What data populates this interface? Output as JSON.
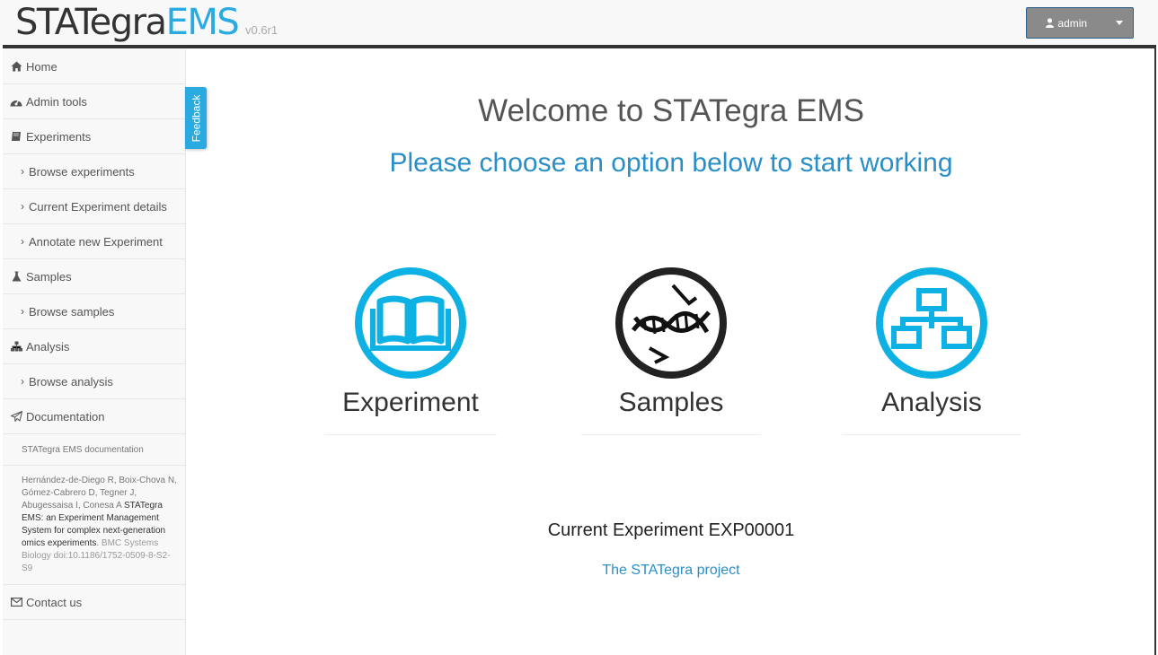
{
  "header": {
    "brand_part1": "STATegra",
    "brand_part2": "EMS",
    "version": "v0.6r1",
    "user_label": "admin"
  },
  "sidebar": {
    "items": [
      {
        "label": "Home",
        "icon": "home-icon"
      },
      {
        "label": "Admin tools",
        "icon": "dashboard-icon"
      },
      {
        "label": "Experiments",
        "icon": "book-icon"
      },
      {
        "label": "Browse experiments"
      },
      {
        "label": "Current Experiment details"
      },
      {
        "label": "Annotate new Experiment"
      },
      {
        "label": "Samples",
        "icon": "flask-icon"
      },
      {
        "label": "Browse samples"
      },
      {
        "label": "Analysis",
        "icon": "sitemap-icon"
      },
      {
        "label": "Browse analysis"
      },
      {
        "label": "Documentation",
        "icon": "paper-plane-icon"
      }
    ],
    "doc_link": "STATegra EMS documentation",
    "citation": {
      "authors": "Hernández-de-Diego R, Boix-Chova N, Gómez-Cabrero D, Tegner J, Abugessaisa I, Conesa A",
      "title": "STATegra EMS: an Experiment Management System for complex next-generation omics experiments",
      "journal": "BMC Systems Biology doi:10.1186/1752-0509-8-S2-S9"
    },
    "contact": {
      "label": "Contact us",
      "icon": "envelope-icon"
    }
  },
  "feedback_tab": "Feedback",
  "main": {
    "title": "Welcome to STATegra EMS",
    "subtitle": "Please choose an option below to start working",
    "options": [
      {
        "label": "Experiment",
        "icon": "open-book-icon"
      },
      {
        "label": "Samples",
        "icon": "dna-icon"
      },
      {
        "label": "Analysis",
        "icon": "sitemap-icon"
      }
    ],
    "current_experiment": "Current Experiment EXP00001",
    "project_link": "The STATegra project"
  },
  "colors": {
    "accent": "#29abe2",
    "link": "#2a8fc7",
    "header_rule": "#333333",
    "sidebar_bg": "#f8f8f8"
  }
}
